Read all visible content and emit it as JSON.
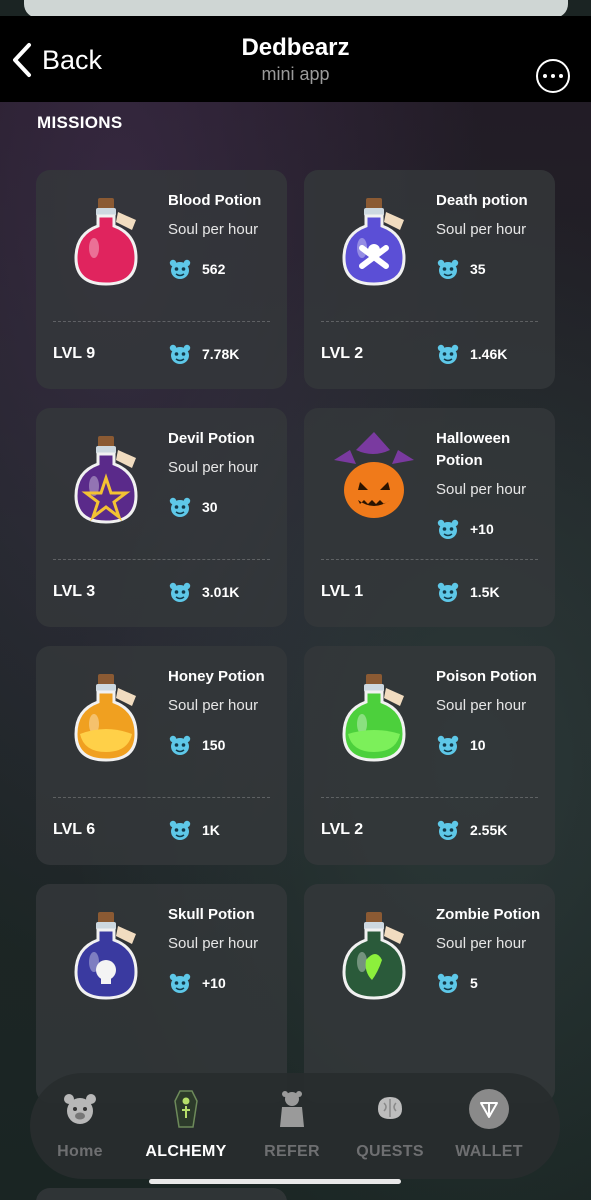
{
  "header": {
    "back_label": "Back",
    "title": "Dedbearz",
    "subtitle": "mini app"
  },
  "section_title": "MISSIONS",
  "cards": [
    {
      "name": "Blood Potion",
      "rate_label": "Soul per hour",
      "rate": "562",
      "level": "LVL 9",
      "cost": "7.78K",
      "icon": "blood-potion-icon",
      "color": "#e0245e"
    },
    {
      "name": "Death potion",
      "rate_label": "Soul per hour",
      "rate": "35",
      "level": "LVL 2",
      "cost": "1.46K",
      "icon": "death-potion-icon",
      "color": "#5b4fd6"
    },
    {
      "name": "Devil Potion",
      "rate_label": "Soul per hour",
      "rate": "30",
      "level": "LVL 3",
      "cost": "3.01K",
      "icon": "devil-potion-icon",
      "color": "#5a2a8a"
    },
    {
      "name": "Halloween Potion",
      "rate_label": "Soul per hour",
      "rate": "+10",
      "level": "LVL 1",
      "cost": "1.5K",
      "icon": "halloween-potion-icon",
      "color": "#f07a1a"
    },
    {
      "name": "Honey Potion",
      "rate_label": "Soul per hour",
      "rate": "150",
      "level": "LVL 6",
      "cost": "1K",
      "icon": "honey-potion-icon",
      "color": "#f0a020"
    },
    {
      "name": "Poison Potion",
      "rate_label": "Soul per hour",
      "rate": "10",
      "level": "LVL 2",
      "cost": "2.55K",
      "icon": "poison-potion-icon",
      "color": "#4cd03c"
    },
    {
      "name": "Skull Potion",
      "rate_label": "Soul per hour",
      "rate": "+10",
      "level": "",
      "cost": "",
      "icon": "skull-potion-icon",
      "color": "#3a3aa0"
    },
    {
      "name": "Zombie Potion",
      "rate_label": "Soul per hour",
      "rate": "5",
      "level": "",
      "cost": "",
      "icon": "zombie-potion-icon",
      "color": "#2a5a3a"
    }
  ],
  "tabs": [
    {
      "label": "Home",
      "icon": "bear-head-icon",
      "active": false
    },
    {
      "label": "ALCHEMY",
      "icon": "coffin-icon",
      "active": true
    },
    {
      "label": "REFER",
      "icon": "bear-figure-icon",
      "active": false
    },
    {
      "label": "QUESTS",
      "icon": "brain-icon",
      "active": false
    },
    {
      "label": "WALLET",
      "icon": "ton-icon",
      "active": false
    }
  ],
  "colors": {
    "coin": "#5ec8e8",
    "accent": "#ffffff",
    "inactive_tab": "#6e6f71"
  }
}
